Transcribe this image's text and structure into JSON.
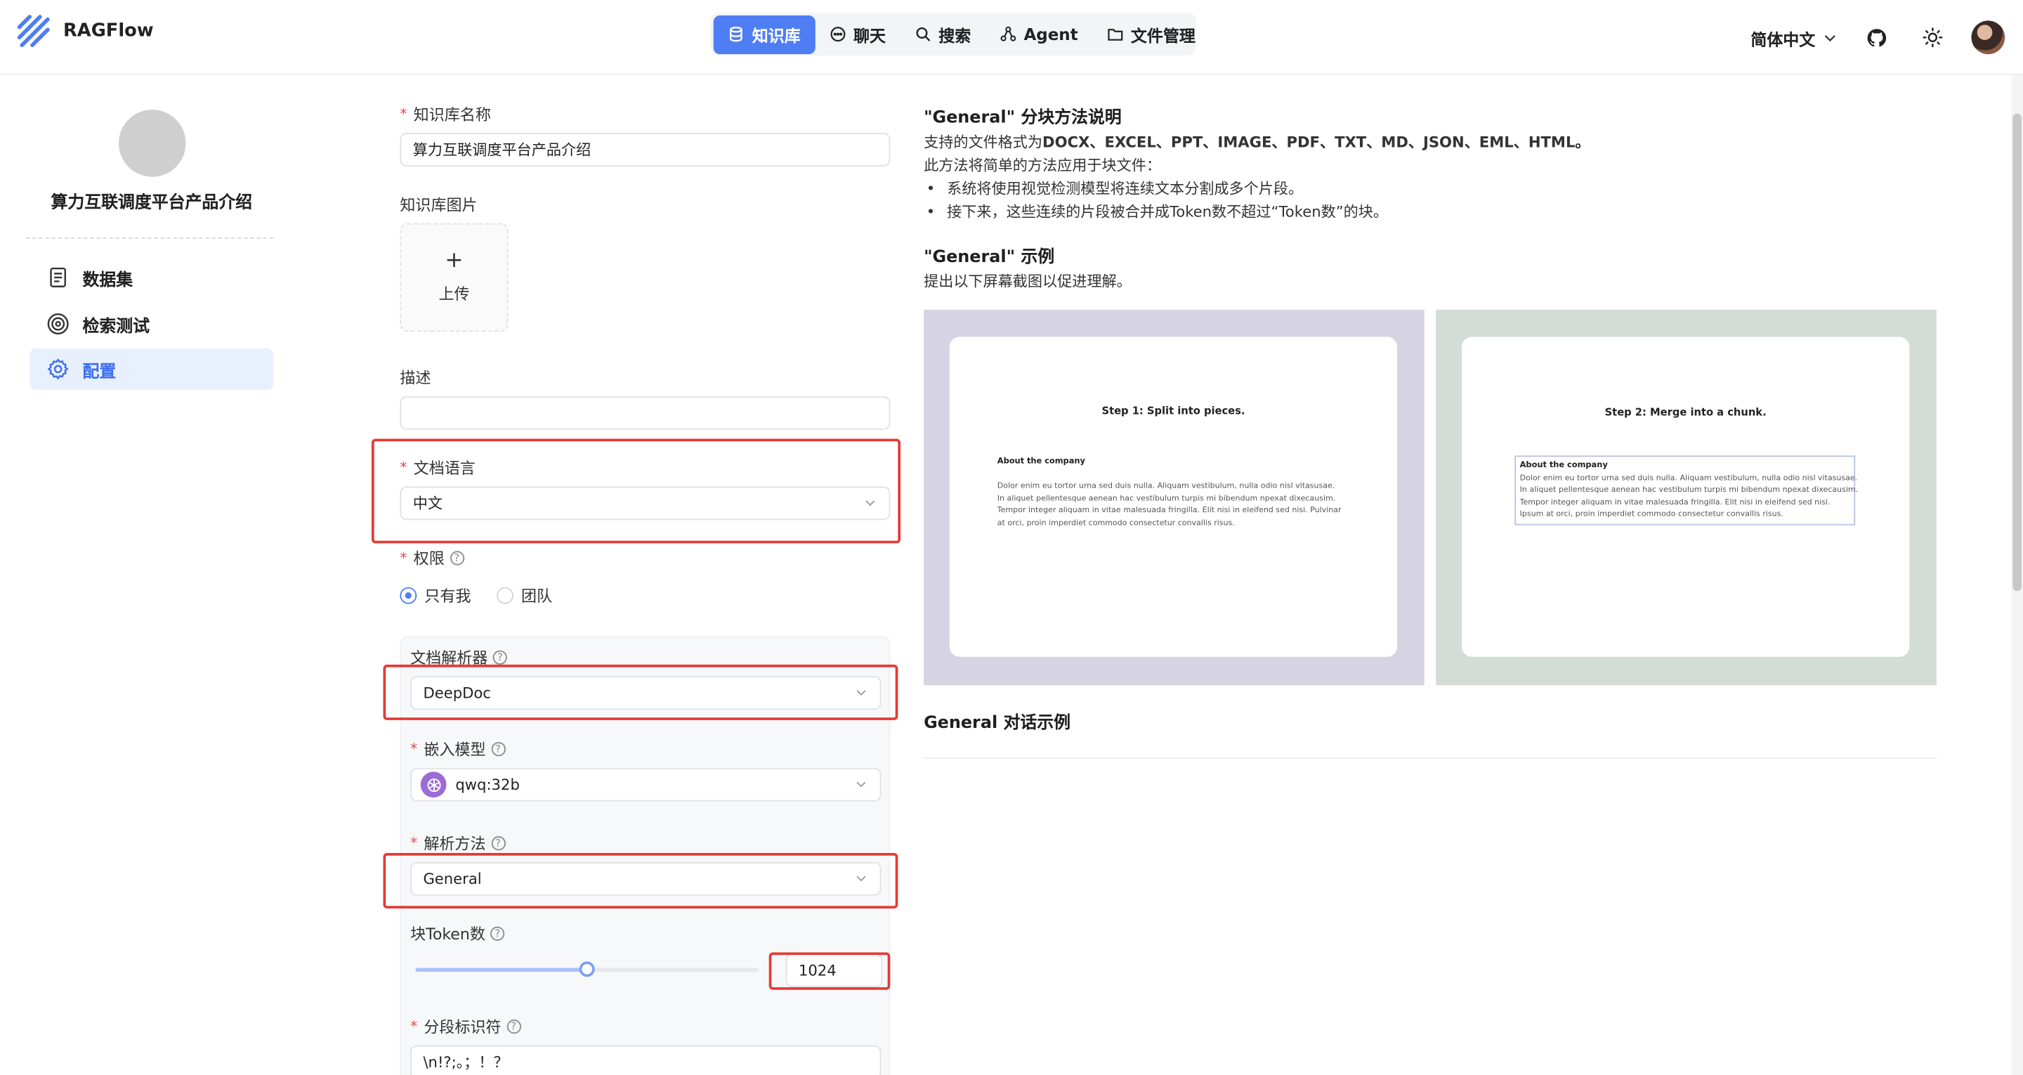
{
  "header": {
    "brand": "RAGFlow",
    "nav": [
      {
        "label": "知识库",
        "icon": "database-icon"
      },
      {
        "label": "聊天",
        "icon": "chat-icon"
      },
      {
        "label": "搜索",
        "icon": "search-icon"
      },
      {
        "label": "Agent",
        "icon": "agent-icon"
      },
      {
        "label": "文件管理",
        "icon": "folder-icon"
      }
    ],
    "language": "简体中文",
    "accent": "#4f7df3"
  },
  "sidebar": {
    "kb_name": "算力互联调度平台产品介绍",
    "items": [
      {
        "label": "数据集",
        "icon": "document-icon"
      },
      {
        "label": "检索测试",
        "icon": "target-icon"
      },
      {
        "label": "配置",
        "icon": "gear-icon"
      }
    ]
  },
  "form": {
    "name_label": "知识库名称",
    "name_value": "算力互联调度平台产品介绍",
    "image_label": "知识库图片",
    "upload_label": "上传",
    "desc_label": "描述",
    "desc_value": "",
    "lang_label": "文档语言",
    "lang_value": "中文",
    "perm_label": "权限",
    "perm_options": [
      "只有我",
      "团队"
    ],
    "parser_label": "文档解析器",
    "parser_value": "DeepDoc",
    "embed_label": "嵌入模型",
    "embed_value": "qwq:32b",
    "method_label": "解析方法",
    "method_value": "General",
    "token_label": "块Token数",
    "token_value": "1024",
    "token_slider_fraction": 0.5,
    "delim_label": "分段标识符",
    "delim_value": "\\n!?;。；！？"
  },
  "right": {
    "title1": "\"General\" 分块方法说明",
    "formats_prefix": "支持的文件格式为",
    "formats": "DOCX、EXCEL、PPT、IMAGE、PDF、TXT、MD、JSON、EML、HTML。",
    "method_intro": "此方法将简单的方法应用于块文件：",
    "bullets": [
      "系统将使用视觉检测模型将连续文本分割成多个片段。",
      "接下来，这些连续的片段被合并成Token数不超过“Token数”的块。"
    ],
    "title2": "\"General\" 示例",
    "example_intro": "提出以下屏幕截图以促进理解。",
    "step1": "Step 1: Split into pieces.",
    "step2": "Step 2: Merge into a chunk.",
    "mini_heading": "About the company",
    "mini_lines": [
      "Dolor enim eu tortor urna sed duis nulla. Aliquam vestibulum, nulla odio nisl vitasusae.",
      "In aliquet pellentesque aenean hac vestibulum turpis mi bibendum npexat dixecausim.",
      "Tempor integer aliquam in vitae malesuada fringilla. Elit nisi in eleifend sed nisi. Pulvinar",
      "at orci, proin imperdiet commodo consectetur convallis risus."
    ],
    "mini_lines2": [
      "Dolor enim eu tortor urna sed duis nulla. Aliquam vestibulum, nulla odio nisl vitasusae.",
      "In aliquet pellentesque aenean hac vestibulum turpis mi bibendum npexat dixecausim.",
      "Tempor integer aliquam in vitae malesuada fringilla. Elit nisi in eleifend sed nisi.",
      "Ipsum at orci, proin imperdiet commodo consectetur convallis risus."
    ],
    "title3": "General 对话示例",
    "shot_colors": [
      "#d6d3e2",
      "#d3dcd5"
    ]
  }
}
